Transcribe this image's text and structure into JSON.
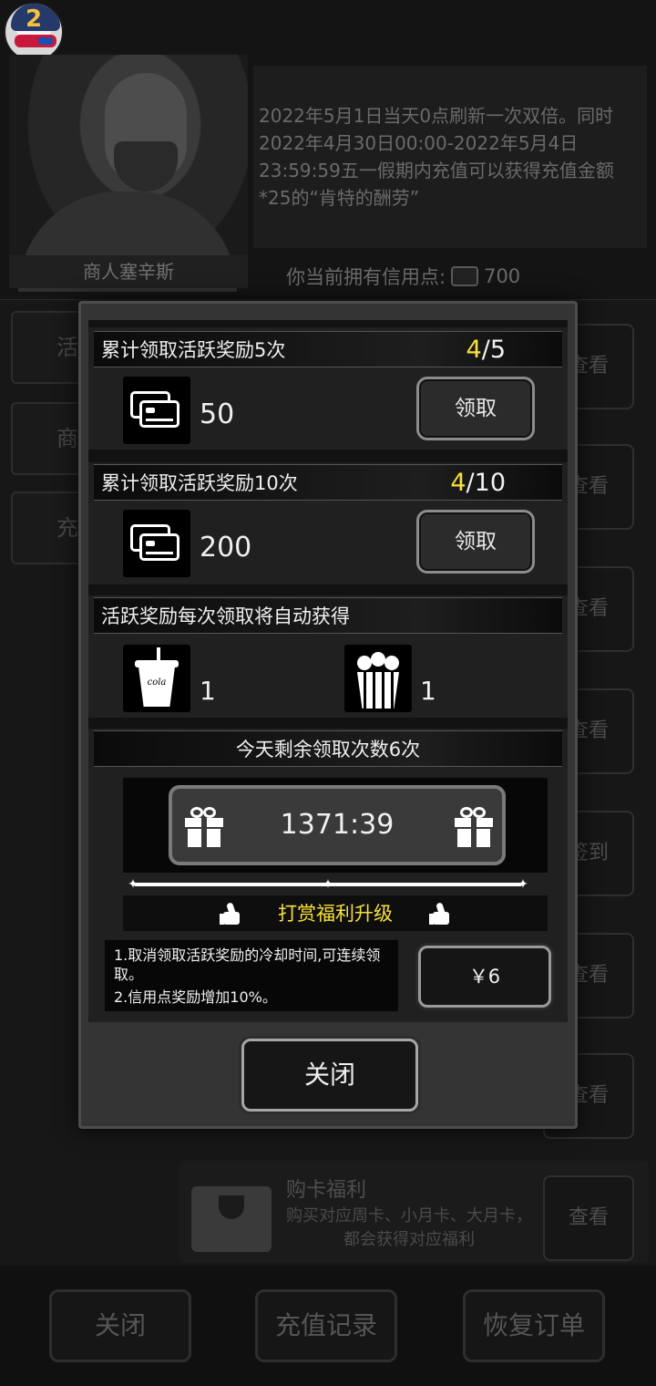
{
  "player": {
    "level_badge": "2"
  },
  "merchant": {
    "name": "商人塞辛斯",
    "notice": "2022年5月1日当天0点刷新一次双倍。同时2022年4月30日00:00-2022年5月4日23:59:59五一假期内充值可以获得充值金额*25的“肯特的酬劳”"
  },
  "credits": {
    "label": "你当前拥有信用点:",
    "value": "700"
  },
  "background": {
    "side_tabs": [
      "活",
      "商",
      "充"
    ],
    "row_buttons": [
      "查看",
      "查看",
      "查看",
      "查看",
      "签到",
      "查看",
      "查看",
      "查看"
    ],
    "card_row": {
      "title": "购卡福利",
      "desc": "购买对应周卡、小月卡、大月卡，都会获得对应福利"
    },
    "bottom": {
      "close": "关闭",
      "records": "充值记录",
      "restore": "恢复订单"
    }
  },
  "modal": {
    "rewards": [
      {
        "title": "累计领取活跃奖励5次",
        "progress_current": "4",
        "progress_sep": "/",
        "progress_total": "5",
        "amount": "50",
        "button": "领取"
      },
      {
        "title": "累计领取活跃奖励10次",
        "progress_current": "4",
        "progress_sep": "/",
        "progress_total": "10",
        "amount": "200",
        "button": "领取"
      }
    ],
    "auto_gain": {
      "title": "活跃奖励每次领取将自动获得",
      "cola_text": "cola",
      "items": [
        {
          "icon": "cola-cup-icon",
          "qty": "1"
        },
        {
          "icon": "popcorn-icon",
          "qty": "1"
        }
      ]
    },
    "remaining": {
      "title": "今天剩余领取次数6次",
      "timer": "1371:39"
    },
    "upgrade": {
      "title": "打赏福利升级",
      "benefit_1": "1.取消领取活跃奖励的冷却时间,可连续领取。",
      "benefit_2": "2.信用点奖励增加10%。",
      "price": "￥6"
    },
    "close": "关闭"
  },
  "colors": {
    "accent_yellow": "#f7e13a",
    "panel": "#343434"
  }
}
